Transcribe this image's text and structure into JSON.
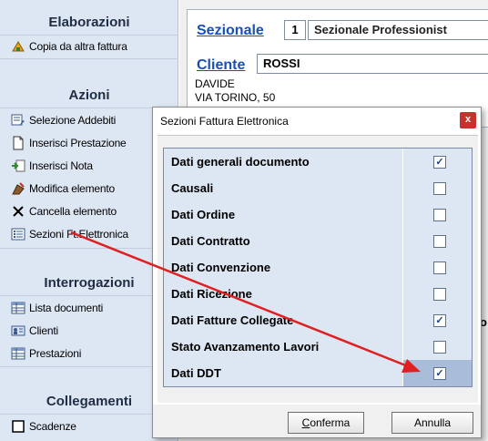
{
  "sidebar": {
    "sections": [
      {
        "title": "Elaborazioni",
        "items": [
          {
            "label": "Copia da altra fattura",
            "icon": "copy-invoice-icon"
          }
        ]
      },
      {
        "title": "Azioni",
        "items": [
          {
            "label": "Selezione Addebiti",
            "icon": "select-charges-icon"
          },
          {
            "label": "Inserisci Prestazione",
            "icon": "document-icon"
          },
          {
            "label": "Inserisci Nota",
            "icon": "insert-note-icon"
          },
          {
            "label": "Modifica elemento",
            "icon": "edit-icon"
          },
          {
            "label": "Cancella elemento",
            "icon": "delete-x-icon"
          },
          {
            "label": "Sezioni Ft.Elettronica",
            "icon": "list-icon"
          }
        ]
      },
      {
        "title": "Interrogazioni",
        "items": [
          {
            "label": "Lista documenti",
            "icon": "table-icon"
          },
          {
            "label": "Clienti",
            "icon": "clients-icon"
          },
          {
            "label": "Prestazioni",
            "icon": "table-icon"
          }
        ]
      },
      {
        "title": "Collegamenti",
        "items": [
          {
            "label": "Scadenze",
            "icon": "checkbox-icon"
          }
        ]
      }
    ]
  },
  "form": {
    "sezionale_label": "Sezionale",
    "sezionale_num": "1",
    "sezionale_name": "Sezionale Professionist",
    "cliente_label": "Cliente",
    "cliente_value": "ROSSI",
    "cliente_line2": "DAVIDE",
    "cliente_line3": "VIA TORINO, 50",
    "partial_letter": "o"
  },
  "dialog": {
    "title": "Sezioni Fattura Elettronica",
    "close_label": "x",
    "rows": [
      {
        "label": "Dati generali documento",
        "checked": true
      },
      {
        "label": "Causali",
        "checked": false
      },
      {
        "label": "Dati Ordine",
        "checked": false
      },
      {
        "label": "Dati Contratto",
        "checked": false
      },
      {
        "label": "Dati Convenzione",
        "checked": false
      },
      {
        "label": "Dati Ricezione",
        "checked": false
      },
      {
        "label": "Dati Fatture Collegate",
        "checked": true
      },
      {
        "label": "Stato Avanzamento Lavori",
        "checked": false
      },
      {
        "label": "Dati DDT",
        "checked": true,
        "selected": true
      }
    ],
    "confirm_label": "Conferma",
    "cancel_label": "Annulla"
  },
  "colors": {
    "panel": "#dde6f3",
    "link": "#1a4fb5",
    "arrow": "#e02020",
    "close": "#c7302b",
    "selected": "#a9bddb"
  }
}
